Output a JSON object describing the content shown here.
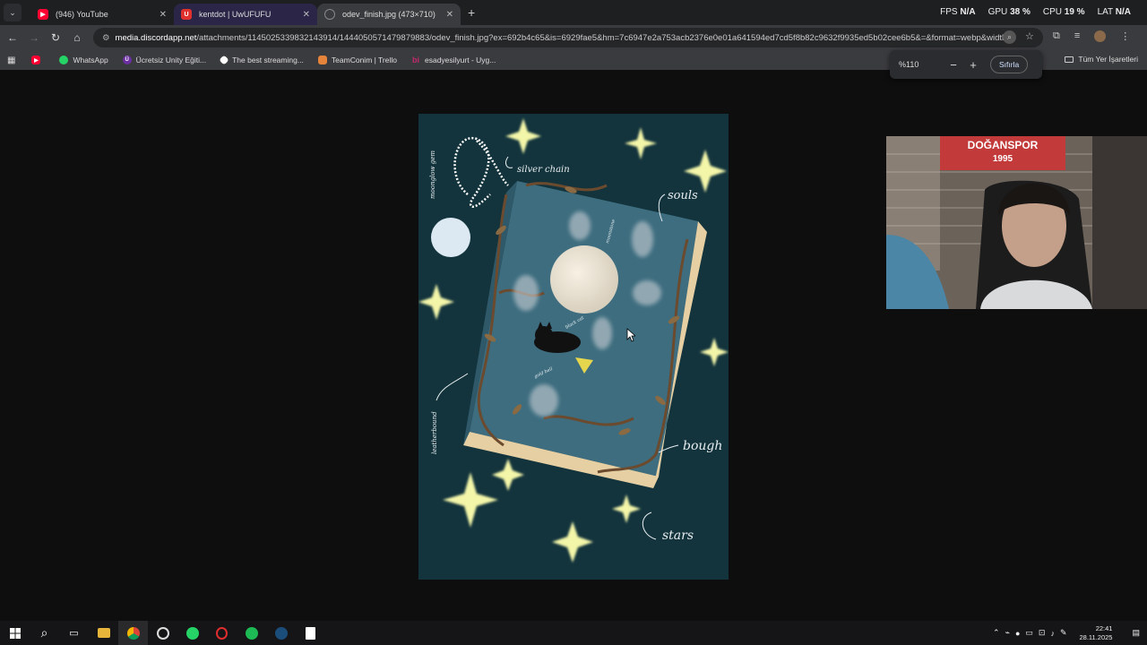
{
  "tabs": [
    {
      "label": "(946) YouTube",
      "fav": "youtube-icon",
      "fav_color": "#ff0033"
    },
    {
      "label": "kentdot | UwUFUFU",
      "fav": "uwufufu-icon",
      "fav_color": "#e0312f"
    },
    {
      "label": "odev_finish.jpg (473×710)",
      "fav": "globe-icon",
      "fav_color": "#888888"
    }
  ],
  "perf": {
    "fps_label": "FPS",
    "fps_value": "N/A",
    "gpu_label": "GPU",
    "gpu_value": "38 %",
    "cpu_label": "CPU",
    "cpu_value": "19 %",
    "lat_label": "LAT",
    "lat_value": "N/A"
  },
  "url": {
    "host": "media.discordapp.net",
    "path": "/attachments/1145025339832143914/1444050571479879883/odev_finish.jpg?ex=692b4c65&is=6929fae5&hm=7c6947e2a753acb2376e0e01a641594ed7cd5f8b82c9632f9935ed5b02cee6b5&=&format=webp&width..."
  },
  "bookmarks": [
    {
      "label": "",
      "icon": "youtube-icon",
      "color": "#ff0033"
    },
    {
      "label": "WhatsApp",
      "icon": "whatsapp-icon",
      "color": "#25d366"
    },
    {
      "label": "Ücretsiz Unity Eğiti...",
      "icon": "unity-course-icon",
      "color": "#6b2fa0"
    },
    {
      "label": "The best streaming...",
      "icon": "streaming-icon",
      "color": "#ffffff"
    },
    {
      "label": "TeamConim | Trello",
      "icon": "trello-icon",
      "color": "#e5843a"
    },
    {
      "label": "esadyesilyurt - Uyg...",
      "icon": "bi-icon",
      "color": "#c22a6d"
    }
  ],
  "all_bookmarks": "Tüm Yer İşaretleri",
  "zoom": {
    "value": "%110",
    "minus": "−",
    "plus": "+",
    "reset": "Sıfırla"
  },
  "image_labels": {
    "silver_chain": "silver chain",
    "souls": "souls",
    "bough": "bough",
    "stars": "stars",
    "moonglow_gem": "moonglow gem",
    "leatherbound": "leatherbound",
    "moonstone": "moonstone",
    "cat_label": "black cat",
    "bell_label": "gold bell"
  },
  "webcam": {
    "banner_text": "DOĞANSPOR",
    "banner_year": "1995"
  },
  "clock": {
    "time": "22:41",
    "date": "28.11.2025"
  },
  "colors": {
    "accent": "#8ab4f8",
    "tab_active": "#3a3b3e",
    "page_bg": "#0e0e0e",
    "image_bg": "#13343d"
  }
}
